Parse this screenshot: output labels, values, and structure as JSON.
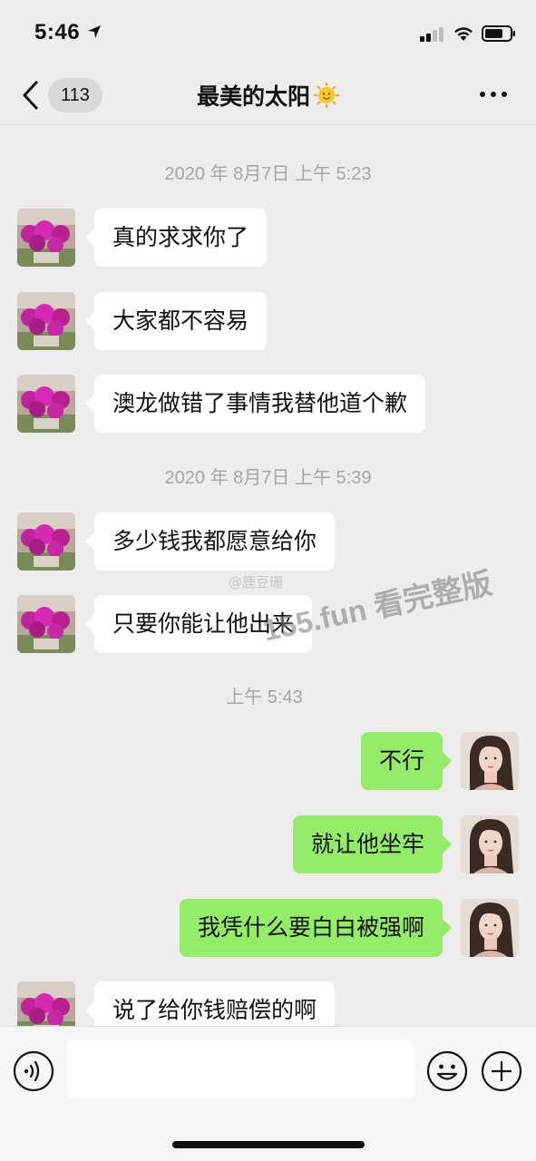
{
  "status_bar": {
    "time": "5:46"
  },
  "nav": {
    "unread_count": "113",
    "title": "最美的太阳",
    "title_emoji": "sun-with-face-icon"
  },
  "messages": [
    {
      "kind": "timestamp",
      "text": "2020 年 8月7日 上午 5:23"
    },
    {
      "kind": "received",
      "text": "真的求求你了"
    },
    {
      "kind": "received",
      "text": "大家都不容易"
    },
    {
      "kind": "received",
      "text": "澳龙做错了事情我替他道个歉"
    },
    {
      "kind": "timestamp",
      "text": "2020 年 8月7日 上午 5:39"
    },
    {
      "kind": "received",
      "text": "多少钱我都愿意给你"
    },
    {
      "kind": "received",
      "text": "只要你能让他出来"
    },
    {
      "kind": "timestamp",
      "text": "上午 5:43"
    },
    {
      "kind": "sent",
      "text": "不行"
    },
    {
      "kind": "sent",
      "text": "就让他坐牢"
    },
    {
      "kind": "sent",
      "text": "我凭什么要白白被强啊"
    },
    {
      "kind": "received",
      "text": "说了给你钱赔偿的啊"
    }
  ],
  "watermark": {
    "weibo": "@鹿豆珊",
    "promo": "155.fun 看完整版"
  },
  "input_bar": {
    "value": ""
  },
  "colors": {
    "sent_bubble": "#95ec69",
    "received_bubble": "#ffffff",
    "background": "#ededed"
  }
}
